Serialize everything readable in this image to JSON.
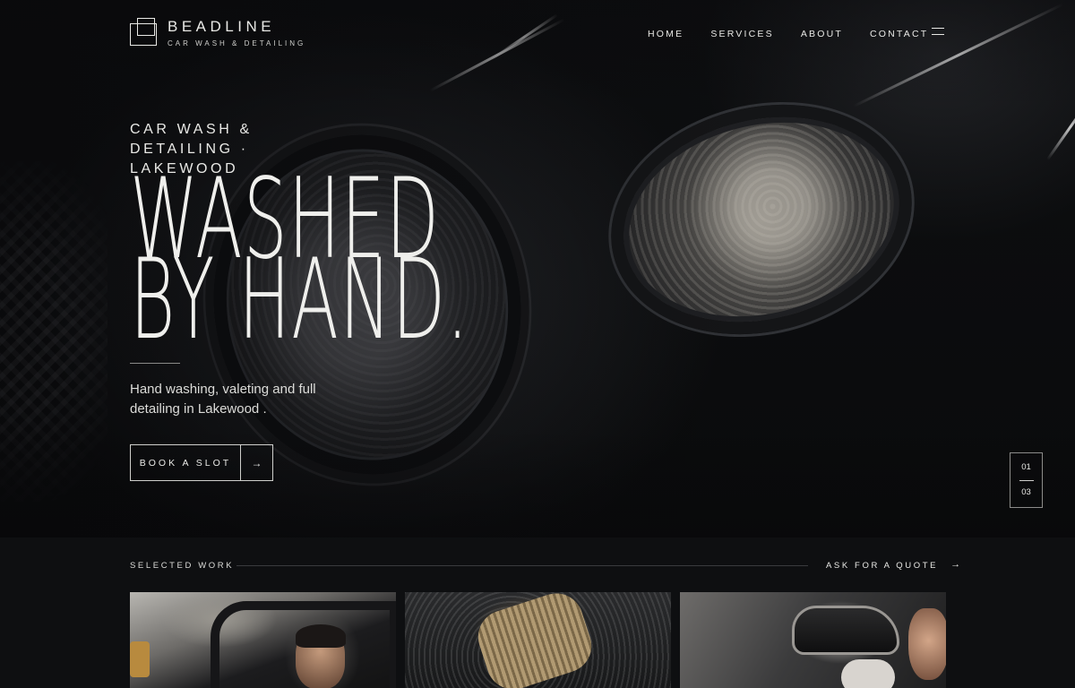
{
  "brand": {
    "name": "BEADLINE",
    "tagline": "CAR WASH & DETAILING"
  },
  "nav": {
    "items": [
      "HOME",
      "SERVICES",
      "ABOUT",
      "CONTACT"
    ]
  },
  "hero": {
    "eyebrow": "CAR WASH & DETAILING · LAKEWOOD",
    "headline_line1": "WASHED",
    "headline_line2": "BY HAND.",
    "intro": "Hand washing, valeting and full detailing in Lakewood .",
    "cta_label": "BOOK A SLOT",
    "cta_arrow": "→",
    "slide_current": "01",
    "slide_total": "03"
  },
  "work": {
    "label": "SELECTED WORK",
    "quote_link": "ASK FOR A QUOTE",
    "quote_arrow": "→"
  },
  "colors": {
    "background": "#0c0d0f",
    "text": "#e9e9e6",
    "section_bg": "#0e0f11"
  }
}
